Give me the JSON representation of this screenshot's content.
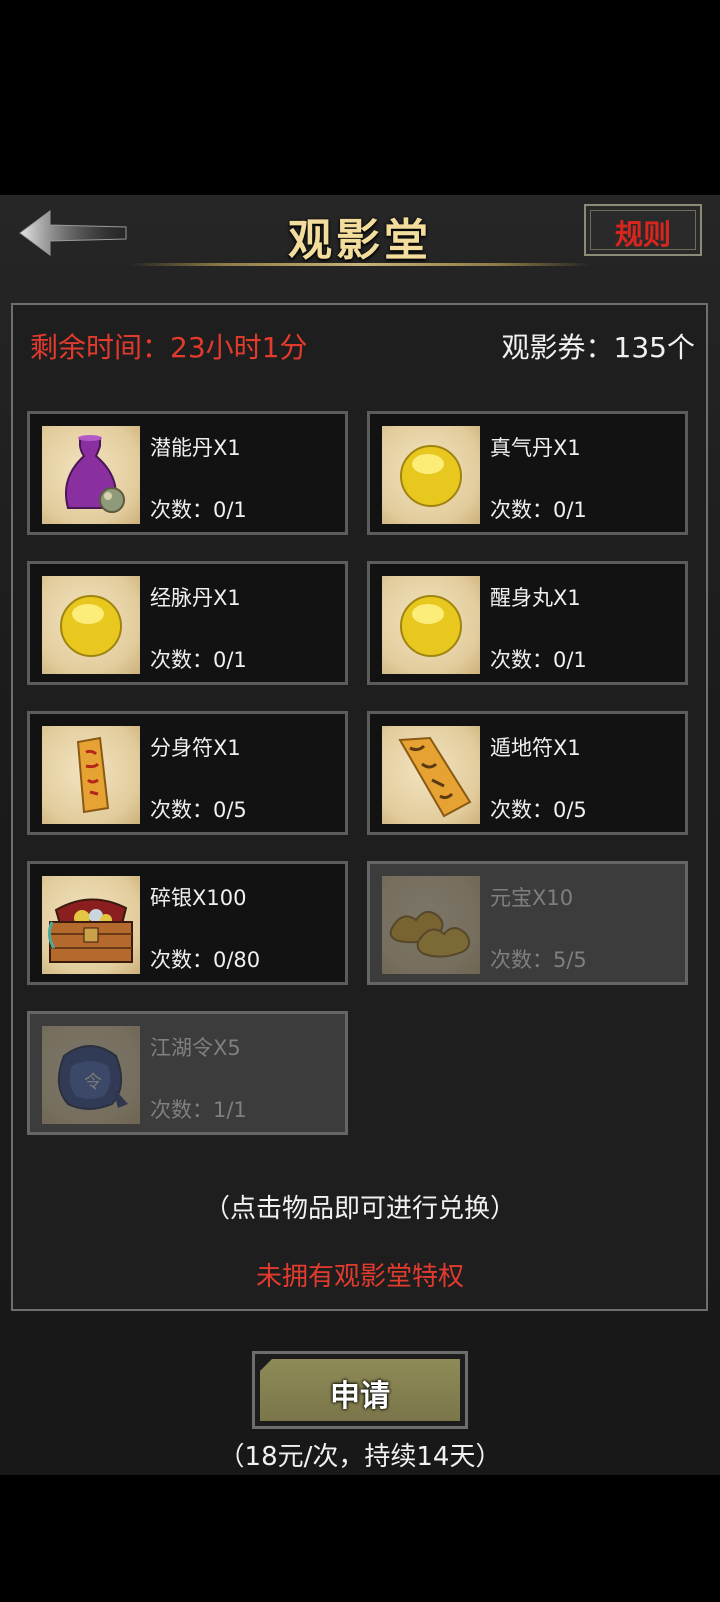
{
  "header": {
    "title": "观影堂",
    "rules_label": "规则"
  },
  "status": {
    "time_label": "剩余时间：23小时1分",
    "ticket_label": "观影券：135个"
  },
  "items": [
    {
      "name": "潜能丹X1",
      "count": "次数：0/1",
      "icon": "purple-vase-icon"
    },
    {
      "name": "真气丹X1",
      "count": "次数：0/1",
      "icon": "golden-pill-icon"
    },
    {
      "name": "经脉丹X1",
      "count": "次数：0/1",
      "icon": "golden-pill-icon"
    },
    {
      "name": "醒身丸X1",
      "count": "次数：0/1",
      "icon": "golden-pill-icon"
    },
    {
      "name": "分身符X1",
      "count": "次数：0/5",
      "icon": "talisman-icon"
    },
    {
      "name": "遁地符X1",
      "count": "次数：0/5",
      "icon": "talisman-icon"
    },
    {
      "name": "碎银X100",
      "count": "次数：0/80",
      "icon": "treasure-chest-icon"
    },
    {
      "name": "元宝X10",
      "count": "次数：5/5",
      "icon": "gold-ingot-icon",
      "exhausted": true
    },
    {
      "name": "江湖令X5",
      "count": "次数：1/1",
      "icon": "token-pouch-icon",
      "exhausted": true
    }
  ],
  "footer": {
    "hint": "（点击物品即可进行兑换）",
    "privilege": "未拥有观影堂特权",
    "apply_label": "申请",
    "price": "（18元/次，持续14天）"
  },
  "colors": {
    "accent_red": "#e23b2e",
    "title_gold": "#f3dd9c",
    "button_olive": "#8f8b57"
  }
}
